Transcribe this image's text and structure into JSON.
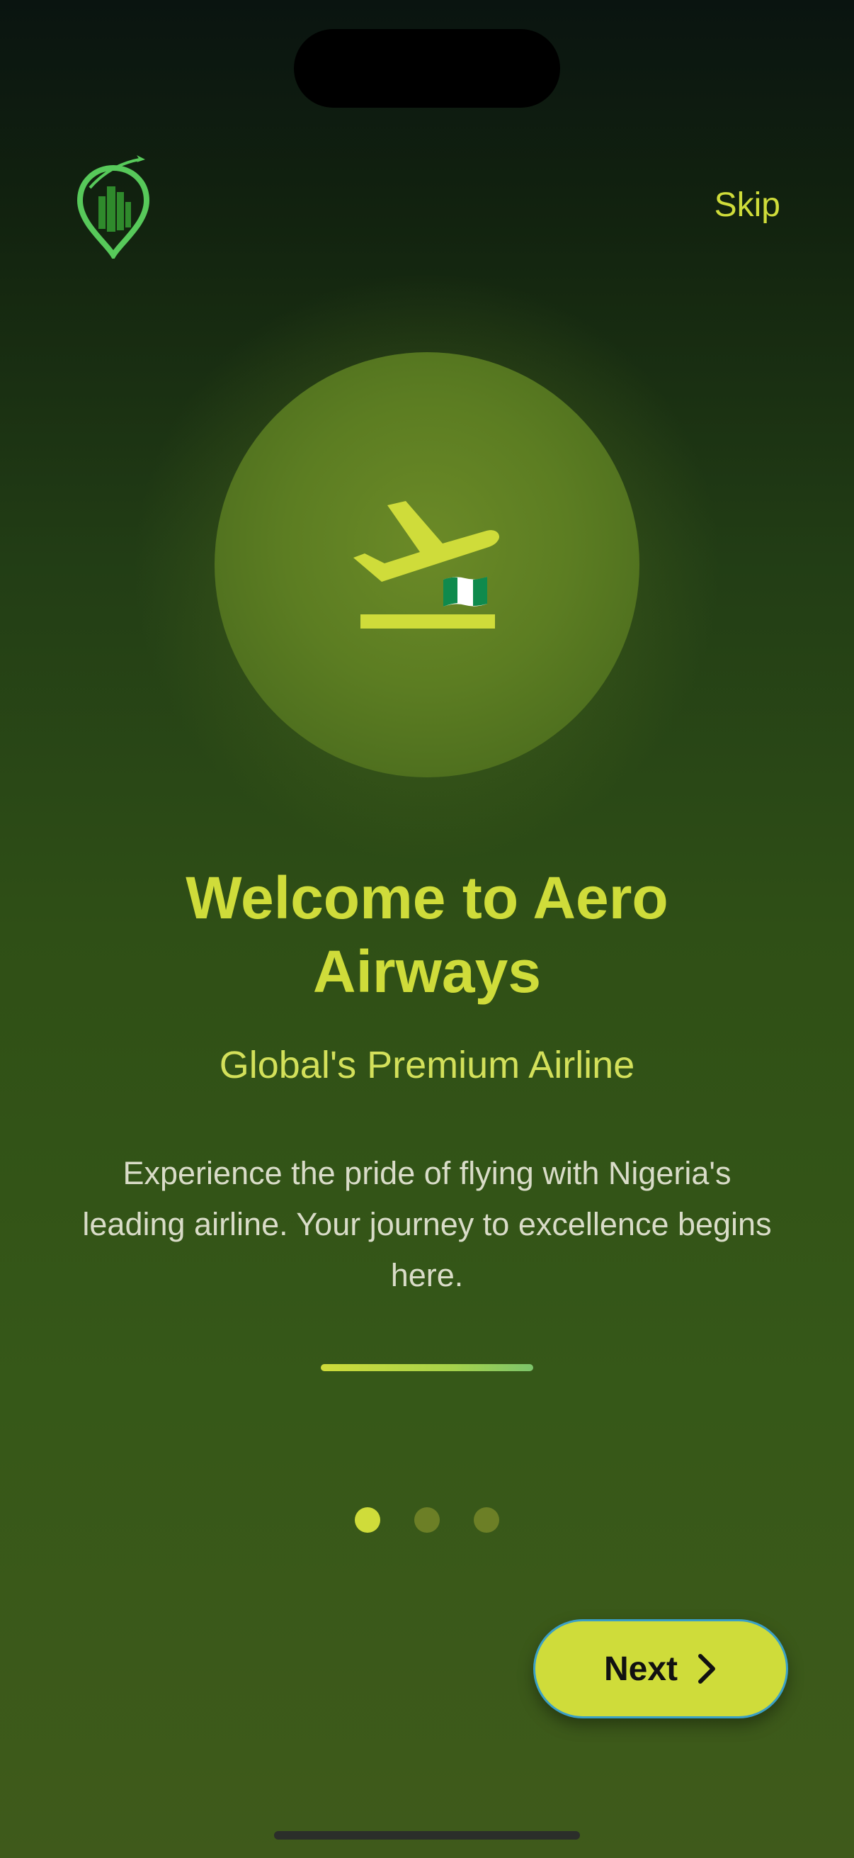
{
  "header": {
    "logo_icon": "location-pin-buildings-plane-logo",
    "skip_label": "Skip"
  },
  "hero": {
    "icon": "flight-takeoff-icon",
    "flag_icon": "nigeria-flag-icon"
  },
  "content": {
    "title": "Welcome to Aero Airways",
    "subtitle": "Global's Premium Airline",
    "description": "Experience the pride of flying with Nigeria's leading airline. Your journey to excellence begins here."
  },
  "pagination": {
    "total": 3,
    "active_index": 0
  },
  "actions": {
    "next_label": "Next",
    "next_icon": "chevron-right-icon"
  },
  "colors": {
    "accent": "#cfdc3a",
    "background_top": "#0a1410",
    "background_bottom": "#3f5a1b",
    "logo_green": "#4fbf4a",
    "dot_inactive": "#6c7f26"
  }
}
